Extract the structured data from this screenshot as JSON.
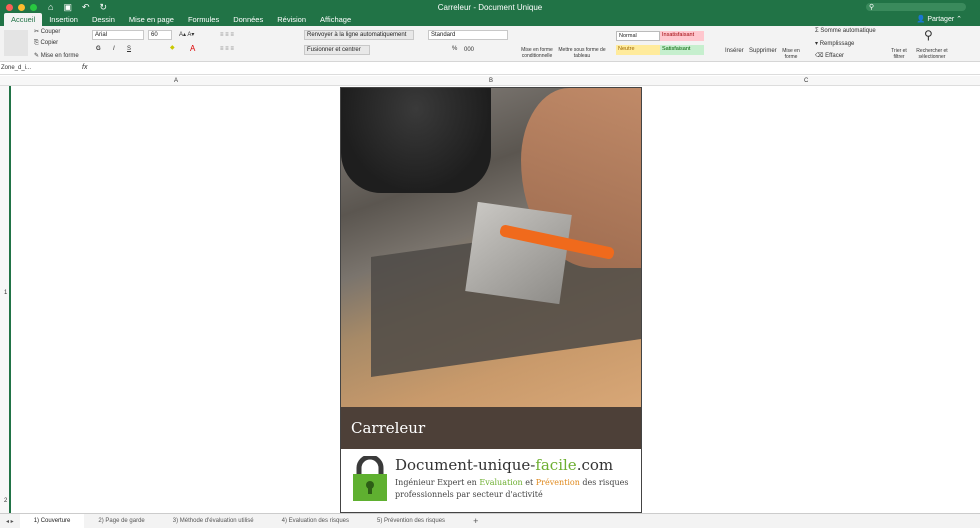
{
  "window": {
    "title": "Carreleur - Document Unique",
    "share": "Partager"
  },
  "tabs": [
    "Accueil",
    "Insertion",
    "Dessin",
    "Mise en page",
    "Formules",
    "Données",
    "Révision",
    "Affichage"
  ],
  "ribbon": {
    "clipboard": [
      "Couper",
      "Copier",
      "Mise en forme"
    ],
    "font": "Arial",
    "size": "60",
    "bold": "G",
    "italic": "I",
    "underline": "S",
    "wrap": "Renvoyer à la ligne automatiquement",
    "merge": "Fusionner et centrer",
    "number_format": "Standard",
    "percent": "%",
    "thousands": "000",
    "cond_format": "Mise en forme conditionnelle",
    "table_format": "Mettre sous forme de tableau",
    "styles": [
      "Normal",
      "Insatisfaisant",
      "Neutre",
      "Satisfaisant"
    ],
    "cells": [
      "Insérer",
      "Supprimer",
      "Mise en forme"
    ],
    "editing": [
      "Somme automatique",
      "Remplissage",
      "Effacer"
    ],
    "sort": "Trier et filtrer",
    "find": "Rechercher et sélectionner"
  },
  "formula_bar": {
    "name_box": "Zone_d_i...",
    "fx": "fx",
    "value": ""
  },
  "columns": [
    "A",
    "B",
    "C"
  ],
  "rows": [
    "1",
    "2"
  ],
  "cover": {
    "title": "Carreleur",
    "brand_a": "Document-unique-",
    "brand_b": "facile",
    "brand_c": ".com",
    "tag1": "Ingénieur Expert en ",
    "tag2": "Evaluation",
    "tag3": " et ",
    "tag4": "Prévention",
    "tag5": " des risques professionnels par secteur d'activité"
  },
  "sheets": [
    "1) Couverture",
    "2) Page de garde",
    "3) Méthode d'évaluation utilisé",
    "4) Evaluation des risques",
    "5) Prévention des risques"
  ],
  "add_sheet": "+"
}
